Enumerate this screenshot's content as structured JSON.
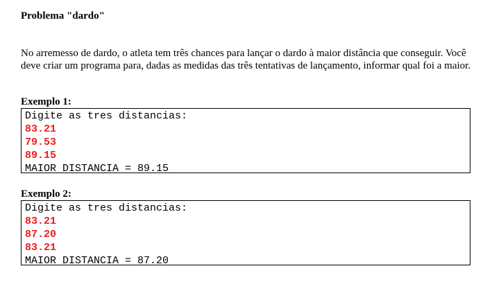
{
  "title": "Problema \"dardo\"",
  "statement": "No arremesso de dardo, o atleta tem três chances para lançar o dardo à maior distância que conseguir. Você deve criar um programa para, dadas as medidas das três tentativas de lançamento, informar qual foi a maior.",
  "examples": [
    {
      "label": "Exemplo 1:",
      "prompt": "Digite as tres distancias:",
      "inputs": [
        "83.21",
        "79.53",
        "89.15"
      ],
      "output": "MAIOR DISTANCIA = 89.15"
    },
    {
      "label": "Exemplo 2:",
      "prompt": "Digite as tres distancias:",
      "inputs": [
        "83.21",
        "87.20",
        "83.21"
      ],
      "output": "MAIOR DISTANCIA = 87.20"
    }
  ],
  "colors": {
    "input_text": "#ee1c1c",
    "text": "#000000",
    "border": "#000000"
  }
}
